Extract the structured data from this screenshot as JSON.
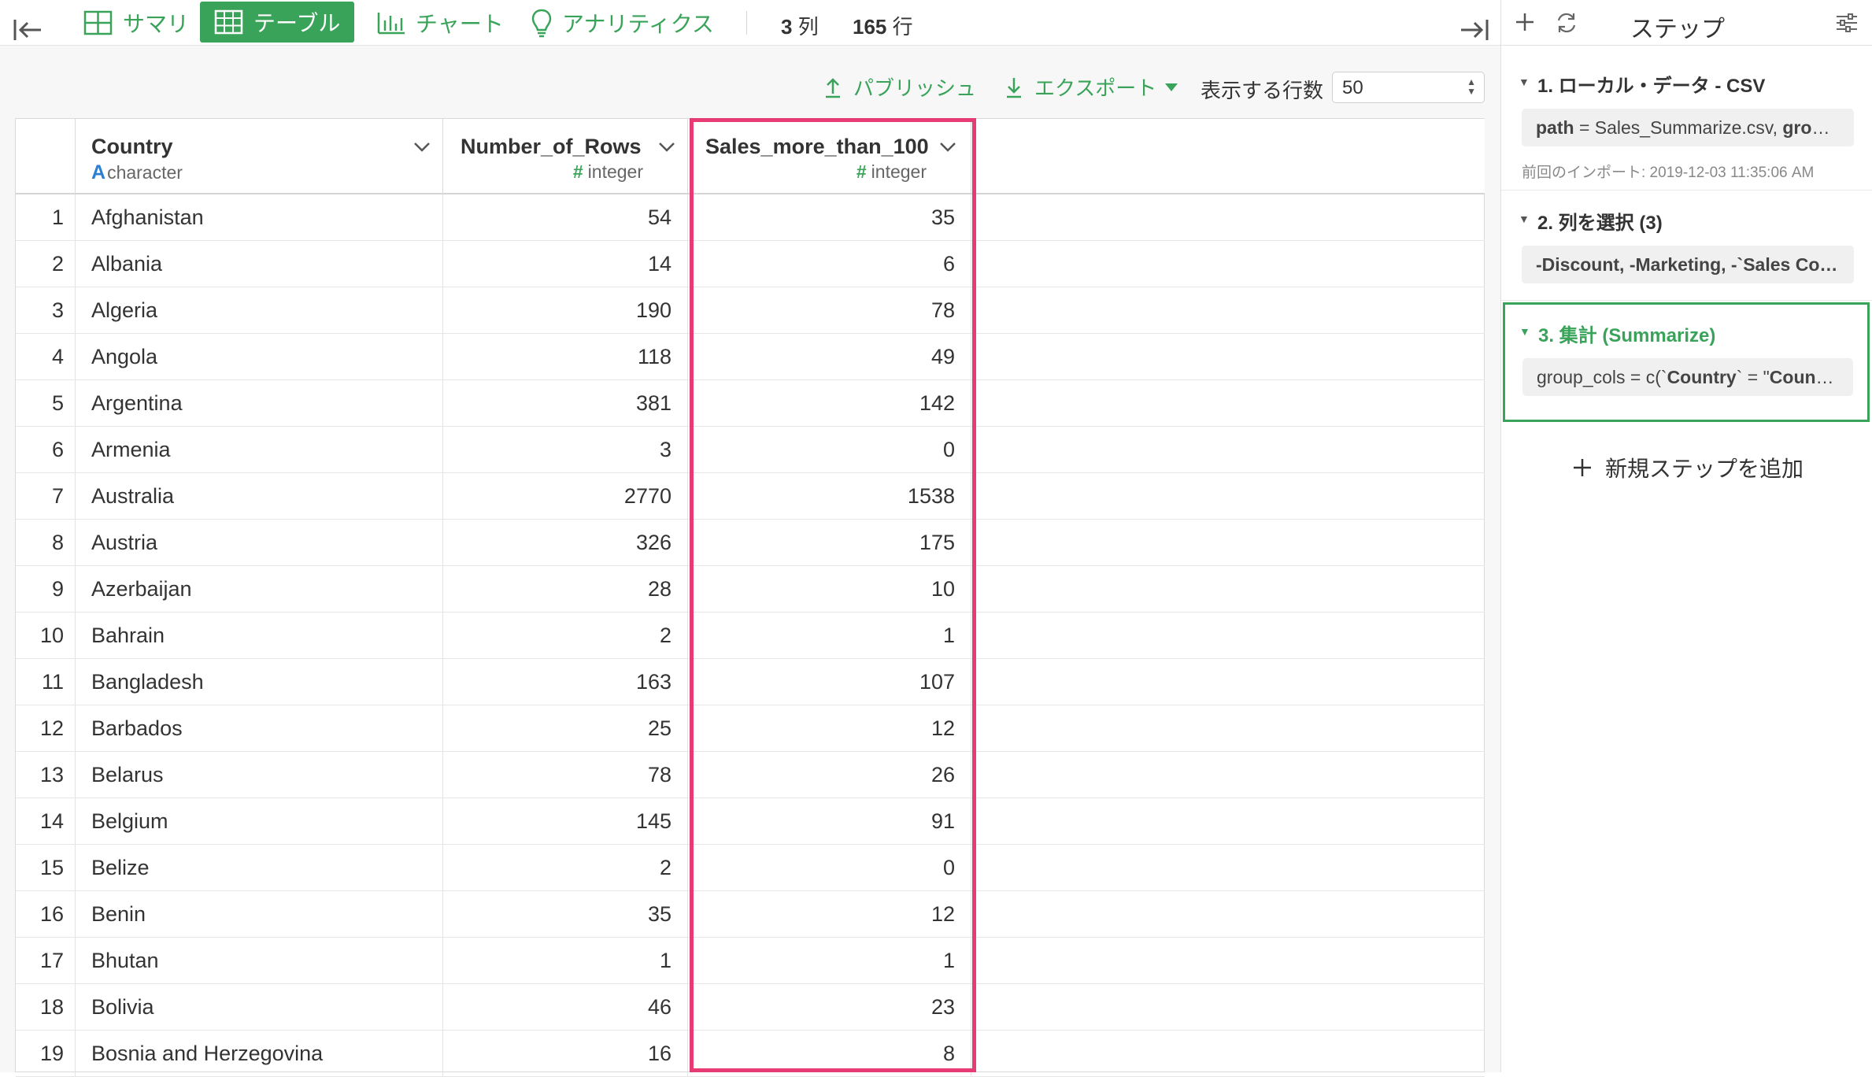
{
  "toolbar": {
    "tabs": {
      "summary": "サマリ",
      "table": "テーブル",
      "chart": "チャート",
      "analytics": "アナリティクス"
    },
    "cols_num": "3",
    "cols_unit": "列",
    "rows_num": "165",
    "rows_unit": "行"
  },
  "actions": {
    "publish": "パブリッシュ",
    "export": "エクスポート",
    "rows_label": "表示する行数",
    "rows_value": "50"
  },
  "table": {
    "columns": [
      {
        "name": "Country",
        "type": "character",
        "type_symbol": "A"
      },
      {
        "name": "Number_of_Rows",
        "type": "integer",
        "type_symbol": "#"
      },
      {
        "name": "Sales_more_than_100",
        "type": "integer",
        "type_symbol": "#"
      }
    ],
    "rows": [
      {
        "idx": "1",
        "country": "Afghanistan",
        "n": "54",
        "s": "35"
      },
      {
        "idx": "2",
        "country": "Albania",
        "n": "14",
        "s": "6"
      },
      {
        "idx": "3",
        "country": "Algeria",
        "n": "190",
        "s": "78"
      },
      {
        "idx": "4",
        "country": "Angola",
        "n": "118",
        "s": "49"
      },
      {
        "idx": "5",
        "country": "Argentina",
        "n": "381",
        "s": "142"
      },
      {
        "idx": "6",
        "country": "Armenia",
        "n": "3",
        "s": "0"
      },
      {
        "idx": "7",
        "country": "Australia",
        "n": "2770",
        "s": "1538"
      },
      {
        "idx": "8",
        "country": "Austria",
        "n": "326",
        "s": "175"
      },
      {
        "idx": "9",
        "country": "Azerbaijan",
        "n": "28",
        "s": "10"
      },
      {
        "idx": "10",
        "country": "Bahrain",
        "n": "2",
        "s": "1"
      },
      {
        "idx": "11",
        "country": "Bangladesh",
        "n": "163",
        "s": "107"
      },
      {
        "idx": "12",
        "country": "Barbados",
        "n": "25",
        "s": "12"
      },
      {
        "idx": "13",
        "country": "Belarus",
        "n": "78",
        "s": "26"
      },
      {
        "idx": "14",
        "country": "Belgium",
        "n": "145",
        "s": "91"
      },
      {
        "idx": "15",
        "country": "Belize",
        "n": "2",
        "s": "0"
      },
      {
        "idx": "16",
        "country": "Benin",
        "n": "35",
        "s": "12"
      },
      {
        "idx": "17",
        "country": "Bhutan",
        "n": "1",
        "s": "1"
      },
      {
        "idx": "18",
        "country": "Bolivia",
        "n": "46",
        "s": "23"
      },
      {
        "idx": "19",
        "country": "Bosnia and Herzegovina",
        "n": "16",
        "s": "8"
      }
    ]
  },
  "steps_panel": {
    "title": "ステップ",
    "steps": [
      {
        "title": "1. ローカル・データ - CSV",
        "detail_bold1": "path",
        "detail_mid": " = Sales_Summarize.csv, ",
        "detail_bold2": "grou…",
        "meta": "前回のインポート: 2019-12-03 11:35:06 AM"
      },
      {
        "title": "2. 列を選択 (3)",
        "detail": "-Discount, -Marketing, -`Sales Co…"
      },
      {
        "title": "3. 集計 (Summarize)",
        "detail_pre": "group_cols = c(`",
        "detail_bold1": "Country",
        "detail_mid": "` = \"",
        "detail_bold2": "Countr…"
      }
    ],
    "add_step": "新規ステップを追加"
  }
}
